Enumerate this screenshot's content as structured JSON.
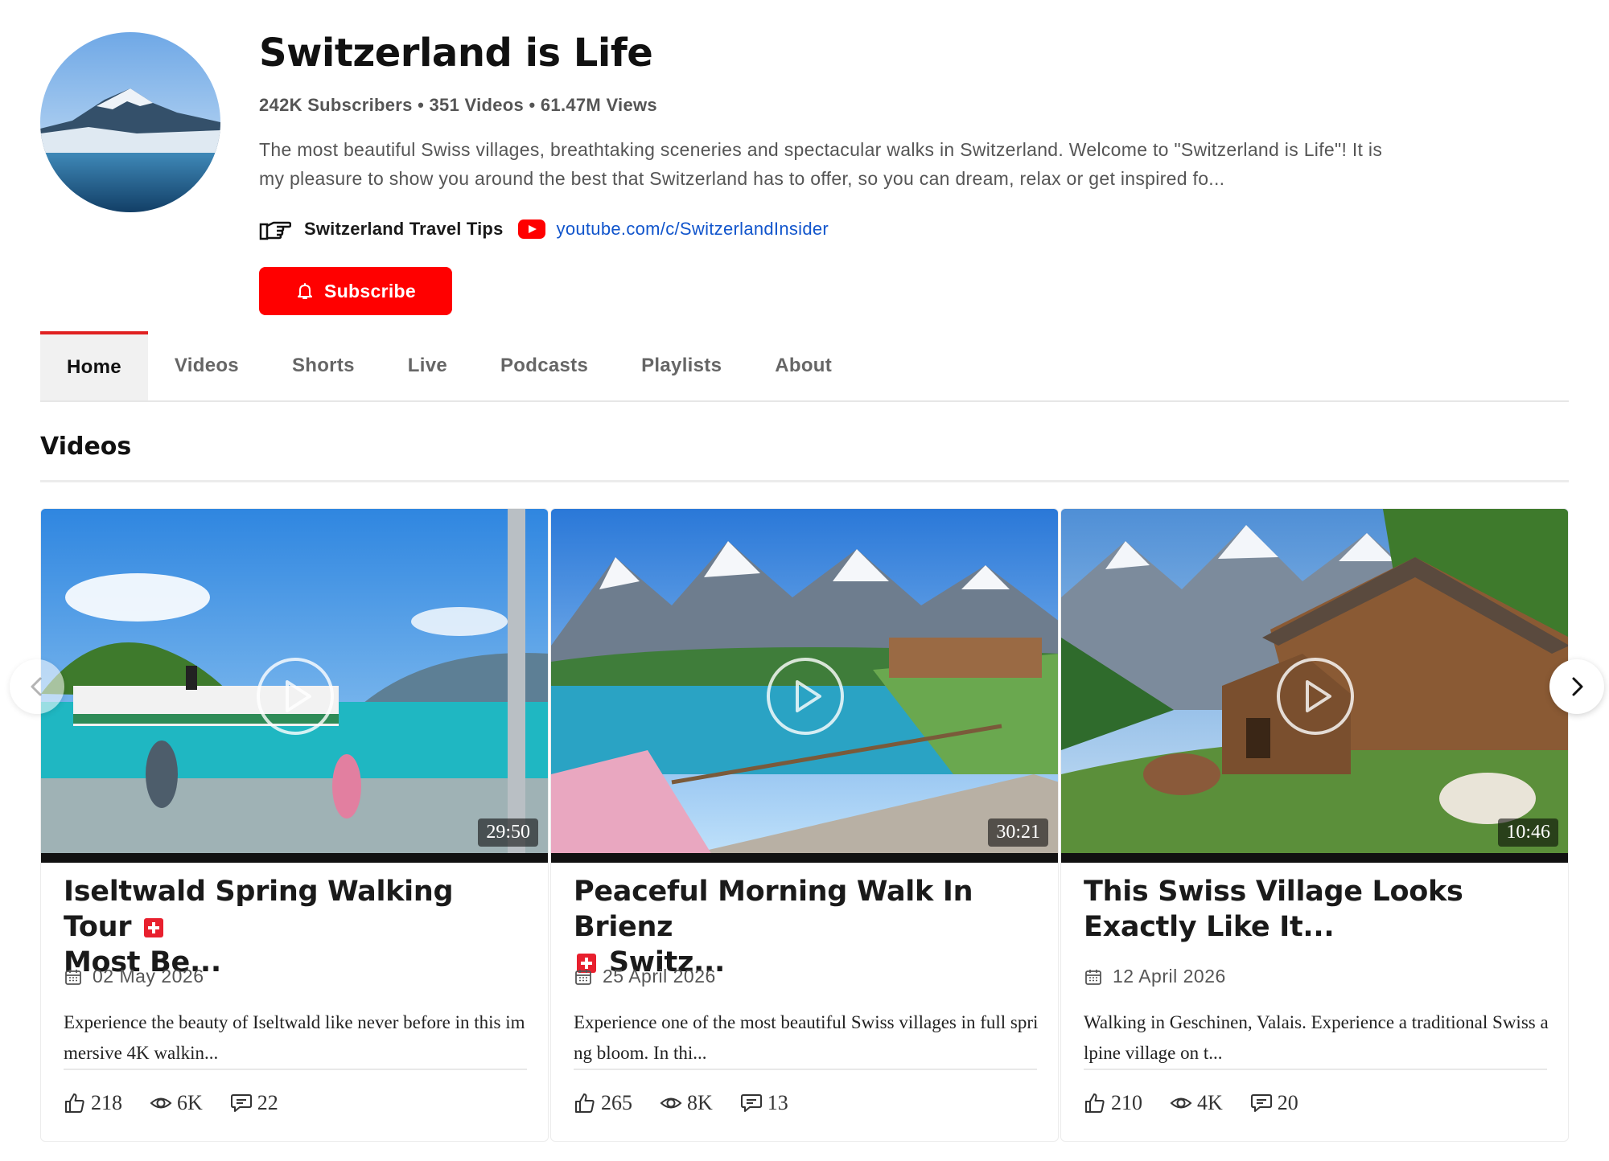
{
  "channel": {
    "name": "Switzerland is Life",
    "stats": "242K Subscribers • 351 Videos • 61.47M Views",
    "description": "The most beautiful Swiss villages, breathtaking sceneries and spectacular walks in Switzerland. Welcome to \"Switzerland is Life\"! It is my pleasure to show you around the best that Switzerland has to offer, so you can dream, relax or get inspired fo...",
    "links": {
      "hand_icon": "pointing-hand-icon",
      "tips_label": "Switzerland Travel Tips",
      "youtube_icon": "youtube-icon",
      "url": "youtube.com/c/SwitzerlandInsider"
    },
    "subscribe_label": "Subscribe"
  },
  "tabs": [
    {
      "label": "Home",
      "active": true
    },
    {
      "label": "Videos",
      "active": false
    },
    {
      "label": "Shorts",
      "active": false
    },
    {
      "label": "Live",
      "active": false
    },
    {
      "label": "Podcasts",
      "active": false
    },
    {
      "label": "Playlists",
      "active": false
    },
    {
      "label": "About",
      "active": false
    }
  ],
  "section": {
    "title": "Videos"
  },
  "videos": [
    {
      "title_pre": "Iseltwald Spring Walking Tour",
      "title_post": "Most Be...",
      "duration": "29:50",
      "date": "02 May 2026",
      "description": "Experience the beauty of Iseltwald like never before in this immersive 4K walkin...",
      "likes": "218",
      "views": "6K",
      "comments": "22"
    },
    {
      "title_pre": "Peaceful Morning Walk In Brienz",
      "title_post": "Switz...",
      "duration": "30:21",
      "date": "25 April 2026",
      "description": "Experience one of the most beautiful Swiss villages in full spring bloom. In thi...",
      "likes": "265",
      "views": "8K",
      "comments": "13"
    },
    {
      "title_pre": "This Swiss Village Looks Exactly Like It...",
      "title_post": "",
      "duration": "10:46",
      "date": "12 April 2026",
      "description": "Walking in Geschinen, Valais. Experience a traditional Swiss alpine village on t...",
      "likes": "210",
      "views": "4K",
      "comments": "20"
    }
  ],
  "colors": {
    "brand_red": "#ff0000",
    "link_blue": "#1155cc",
    "active_tab_bg": "#f1f1f1"
  }
}
